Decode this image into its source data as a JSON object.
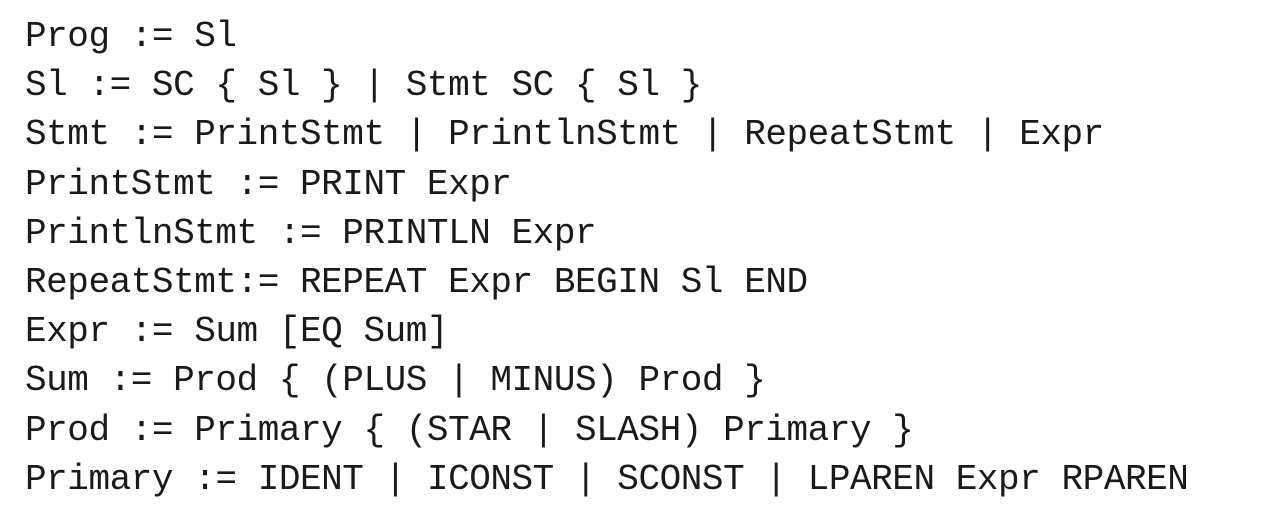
{
  "grammar": {
    "rules": [
      "Prog := Sl",
      "Sl := SC { Sl } | Stmt SC { Sl }",
      "Stmt := PrintStmt | PrintlnStmt | RepeatStmt | Expr",
      "PrintStmt := PRINT Expr",
      "PrintlnStmt := PRINTLN Expr",
      "RepeatStmt:= REPEAT Expr BEGIN Sl END",
      "Expr := Sum [EQ Sum]",
      "Sum := Prod { (PLUS | MINUS) Prod }",
      "Prod := Primary { (STAR | SLASH) Primary }",
      "Primary := IDENT | ICONST | SCONST | LPAREN Expr RPAREN"
    ]
  }
}
